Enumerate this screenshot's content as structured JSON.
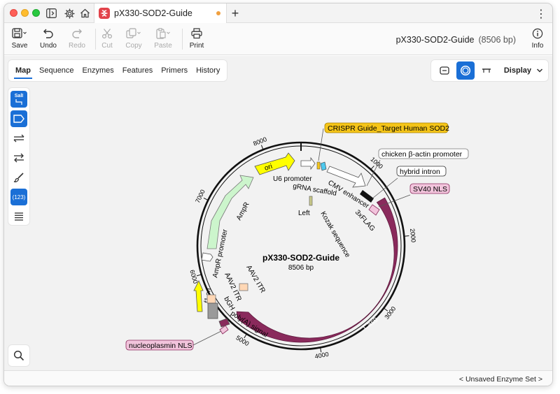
{
  "window": {
    "tab_title": "pX330-SOD2-Guide",
    "new_tab_glyph": "+",
    "menu_glyph": "⋮"
  },
  "toolbar": {
    "save": "Save",
    "undo": "Undo",
    "redo": "Redo",
    "cut": "Cut",
    "copy": "Copy",
    "paste": "Paste",
    "print": "Print",
    "info": "Info",
    "sequence_name": "pX330-SOD2-Guide",
    "sequence_length": "(8506 bp)"
  },
  "view_tabs": [
    "Map",
    "Sequence",
    "Enzymes",
    "Features",
    "Primers",
    "History"
  ],
  "active_view_tab": "Map",
  "display": {
    "label": "Display"
  },
  "left_tools": {
    "enzyme_label": "SalI",
    "numbers_label": "(123)"
  },
  "status": {
    "enzyme_set": "< Unsaved Enzyme Set >"
  },
  "map": {
    "title": "pX330-SOD2-Guide",
    "length_label": "8506 bp",
    "total_bp": 8506,
    "ticks": [
      {
        "bp": 1000,
        "label": "1000"
      },
      {
        "bp": 2000,
        "label": "2000"
      },
      {
        "bp": 3000,
        "label": "3000"
      },
      {
        "bp": 4000,
        "label": "4000"
      },
      {
        "bp": 5000,
        "label": "5000"
      },
      {
        "bp": 6000,
        "label": "6000"
      },
      {
        "bp": 7000,
        "label": "7000"
      },
      {
        "bp": 8000,
        "label": "8000"
      }
    ],
    "features": {
      "cas9": "Cas9",
      "ori": "ori",
      "ampr": "AmpR",
      "ampr_promoter": "AmpR promoter",
      "f1_ori": "f1 ori",
      "u6_promoter": "U6 promoter",
      "grna_scaffold": "gRNA scaffold",
      "cmv_enhancer": "CMV enhancer",
      "left": "Left",
      "kozak": "Kozak sequence",
      "flag": "3xFLAG",
      "aav2_itr_a": "AAV2 ITR",
      "aav2_itr_b": "AAV2 ITR",
      "bgh": "bGH",
      "polya": "poly(A) signal"
    },
    "callouts": {
      "crispr": "CRISPR Guide_Target Human SOD2",
      "chicken": "chicken β-actin promoter",
      "hybrid": "hybrid intron",
      "sv40": "SV40 NLS",
      "nucleoplasmin": "nucleoplasmin NLS"
    },
    "colors": {
      "cas9": "#8a2a5c",
      "ori": "#ffff00",
      "ampr": "#ccf5cc",
      "nls": "#f2c4dc",
      "crispr": "#f5c518",
      "bgh": "#9a9a9a",
      "aav2": "#ffd7b5",
      "u6": "#4ec9ef",
      "accent": "#1a6fd6"
    }
  }
}
